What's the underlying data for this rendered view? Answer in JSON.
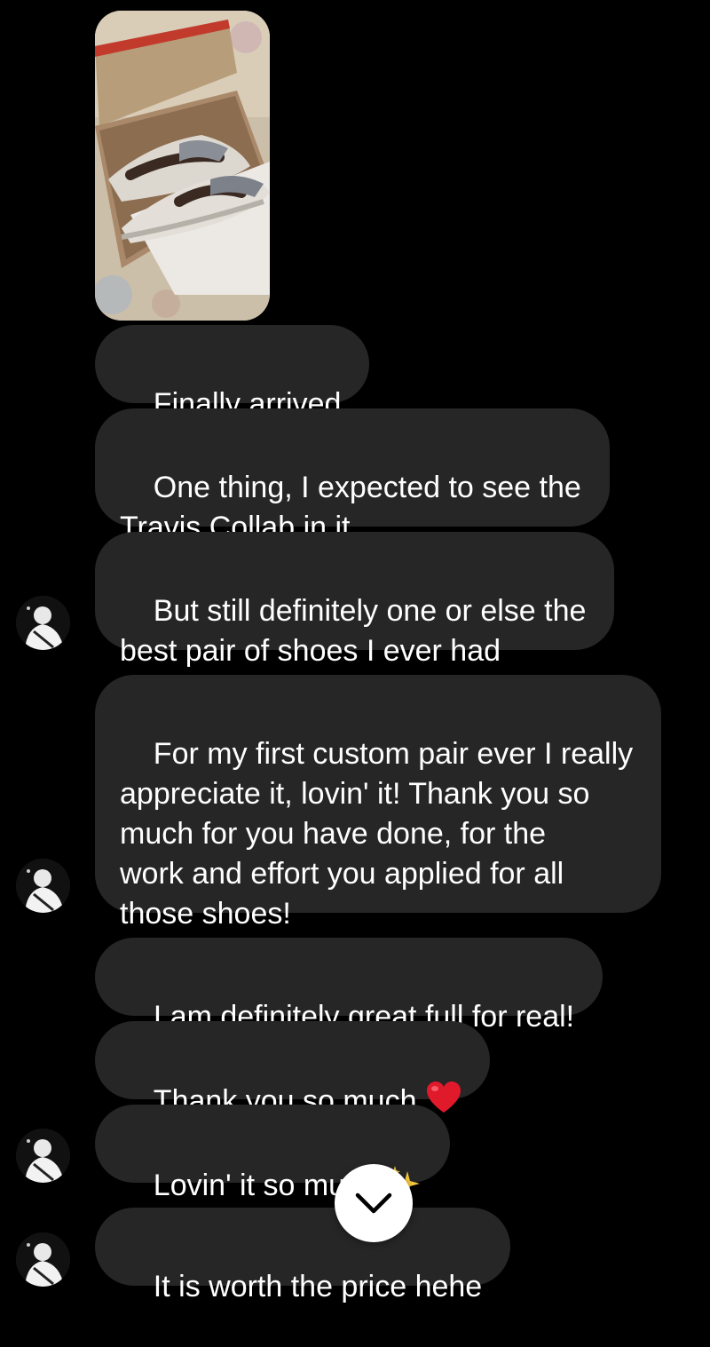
{
  "messages": [
    {
      "text": "Finally arrived"
    },
    {
      "text": "One thing, I expected to see the\nTravis Collab in it"
    },
    {
      "text": "But still definitely one or else the\nbest pair of shoes I ever had"
    },
    {
      "text": "For my first custom pair ever I really\nappreciate it, lovin' it! Thank you so\nmuch for you have done, for the\nwork and effort you applied for all\nthose shoes!"
    },
    {
      "text": "I am definitely great full for real!"
    },
    {
      "text": "Thank you so much",
      "emoji": "heart-emoji"
    },
    {
      "text": "Lovin' it so much",
      "emoji": "sparkles-emoji"
    },
    {
      "text": "It is worth the price hehe"
    }
  ],
  "icons": {
    "scroll_down": "chevron-down-icon",
    "avatar": "avatar-photo"
  },
  "colors": {
    "background": "#000000",
    "bubble": "#262626",
    "text": "#ffffff",
    "heart": "#e0192b",
    "sparkle": "#f7c93a"
  }
}
